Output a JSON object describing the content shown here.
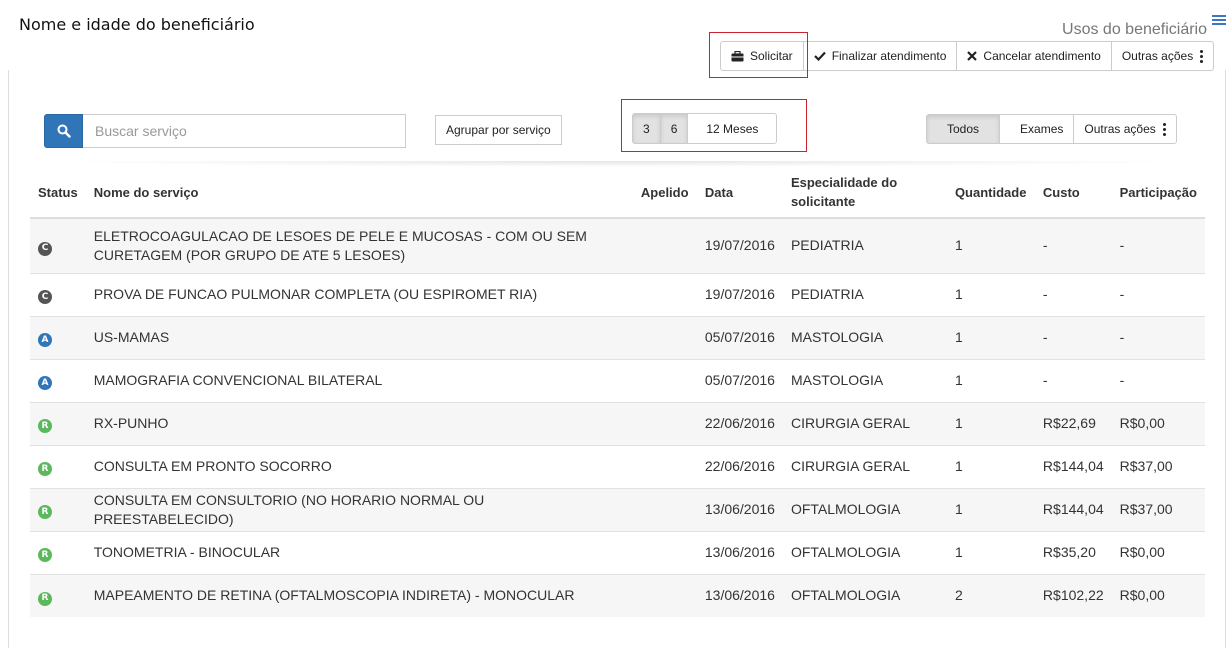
{
  "header": {
    "title": "Nome e idade do beneficiário",
    "usos_label": "Usos do beneficiário"
  },
  "actions": {
    "solicitar": "Solicitar",
    "finalizar": "Finalizar atendimento",
    "cancelar": "Cancelar atendimento",
    "outras": "Outras ações"
  },
  "search": {
    "placeholder": "Buscar serviço"
  },
  "group_button": "Agrupar por serviço",
  "period": [
    "3",
    "6",
    "12 Meses"
  ],
  "filter": {
    "todos": "Todos",
    "exames": "Exames",
    "outras": "Outras ações"
  },
  "colors": {
    "accent": "#2f75b8",
    "status_C": "#555555",
    "status_A": "#2f75b8",
    "status_R": "#5cb85c",
    "highlight": "#c8242f"
  },
  "table": {
    "headers": {
      "status": "Status",
      "nome": "Nome do serviço",
      "apelido": "Apelido",
      "data": "Data",
      "especialidade": "Especialidade do solicitante",
      "quantidade": "Quantidade",
      "custo": "Custo",
      "participacao": "Participação"
    },
    "rows": [
      {
        "status": "C",
        "nome": "ELETROCOAGULACAO DE LESOES DE PELE E MUCOSAS - COM OU SEM CURETAGEM (POR GRUPO DE ATE 5 LESOES)",
        "apelido": "",
        "data": "19/07/2016",
        "especialidade": "PEDIATRIA",
        "quantidade": "1",
        "custo": "-",
        "participacao": "-"
      },
      {
        "status": "C",
        "nome": "PROVA DE FUNCAO PULMONAR COMPLETA (OU ESPIROMET RIA)",
        "apelido": "",
        "data": "19/07/2016",
        "especialidade": "PEDIATRIA",
        "quantidade": "1",
        "custo": "-",
        "participacao": "-"
      },
      {
        "status": "A",
        "nome": "US-MAMAS",
        "apelido": "",
        "data": "05/07/2016",
        "especialidade": "MASTOLOGIA",
        "quantidade": "1",
        "custo": "-",
        "participacao": "-"
      },
      {
        "status": "A",
        "nome": "MAMOGRAFIA CONVENCIONAL BILATERAL",
        "apelido": "",
        "data": "05/07/2016",
        "especialidade": "MASTOLOGIA",
        "quantidade": "1",
        "custo": "-",
        "participacao": "-"
      },
      {
        "status": "R",
        "nome": "RX-PUNHO",
        "apelido": "",
        "data": "22/06/2016",
        "especialidade": "CIRURGIA GERAL",
        "quantidade": "1",
        "custo": "R$22,69",
        "participacao": "R$0,00"
      },
      {
        "status": "R",
        "nome": "CONSULTA EM PRONTO SOCORRO",
        "apelido": "",
        "data": "22/06/2016",
        "especialidade": "CIRURGIA GERAL",
        "quantidade": "1",
        "custo": "R$144,04",
        "participacao": "R$37,00"
      },
      {
        "status": "R",
        "nome": "CONSULTA EM CONSULTORIO (NO HORARIO NORMAL OU PREESTABELECIDO)",
        "apelido": "",
        "data": "13/06/2016",
        "especialidade": "OFTALMOLOGIA",
        "quantidade": "1",
        "custo": "R$144,04",
        "participacao": "R$37,00"
      },
      {
        "status": "R",
        "nome": "TONOMETRIA - BINOCULAR",
        "apelido": "",
        "data": "13/06/2016",
        "especialidade": "OFTALMOLOGIA",
        "quantidade": "1",
        "custo": "R$35,20",
        "participacao": "R$0,00"
      },
      {
        "status": "R",
        "nome": "MAPEAMENTO DE RETINA (OFTALMOSCOPIA INDIRETA) - MONOCULAR",
        "apelido": "",
        "data": "13/06/2016",
        "especialidade": "OFTALMOLOGIA",
        "quantidade": "2",
        "custo": "R$102,22",
        "participacao": "R$0,00"
      }
    ]
  }
}
